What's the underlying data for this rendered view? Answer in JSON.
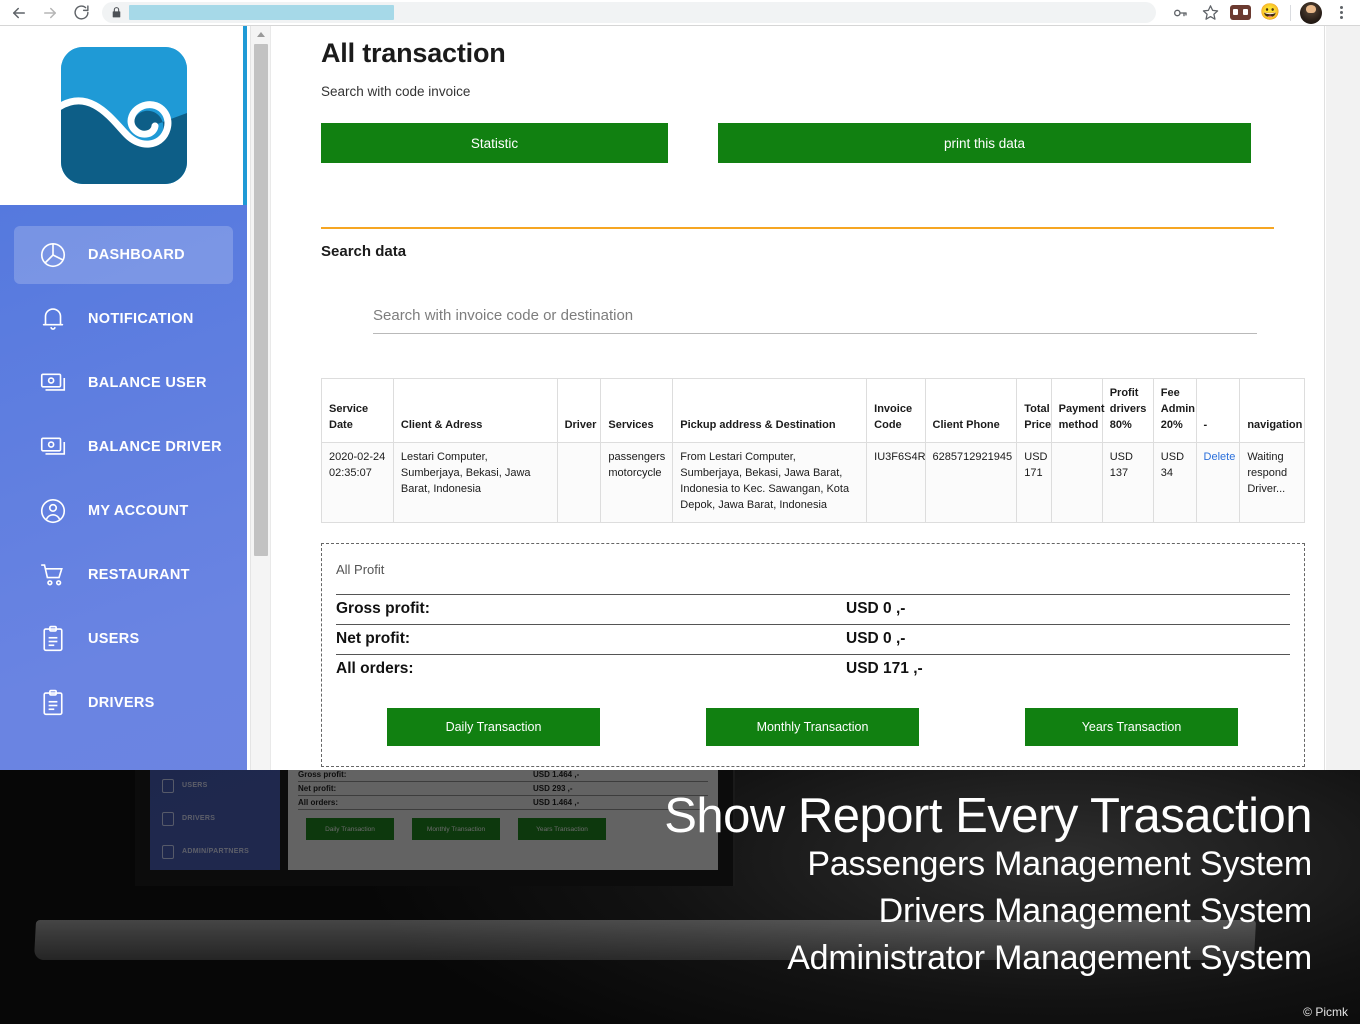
{
  "browser": {
    "back_icon": "back-arrow-icon",
    "forward_icon": "forward-arrow-icon",
    "reload_icon": "reload-icon",
    "lock_icon": "lock-icon",
    "url_value": "",
    "url_placeholder": "",
    "password_key_icon": "key-icon",
    "bookmark_icon": "star-icon",
    "extension_mask_icon": "mask-extension-icon",
    "extension_emoji_icon": "smiley-extension-icon",
    "profile_avatar": "profile-avatar",
    "menu_icon": "three-dot-menu-icon"
  },
  "sidebar": {
    "logo_alt": "wave-logo",
    "items": [
      {
        "label": "DASHBOARD",
        "icon": "pie-chart-icon",
        "active": true
      },
      {
        "label": "NOTIFICATION",
        "icon": "bell-icon",
        "active": false
      },
      {
        "label": "BALANCE USER",
        "icon": "banknotes-icon",
        "active": false
      },
      {
        "label": "BALANCE DRIVER",
        "icon": "banknotes-icon",
        "active": false
      },
      {
        "label": "MY ACCOUNT",
        "icon": "user-circle-icon",
        "active": false
      },
      {
        "label": "RESTAURANT",
        "icon": "cart-icon",
        "active": false
      },
      {
        "label": "USERS",
        "icon": "clipboard-icon",
        "active": false
      },
      {
        "label": "DRIVERS",
        "icon": "clipboard-icon",
        "active": false
      }
    ]
  },
  "main": {
    "title": "All transaction",
    "subtitle": "Search with code invoice",
    "statistic_button": "Statistic",
    "print_button": "print this data",
    "search_section_title": "Search data",
    "search_placeholder": "Search with invoice code or destination",
    "search_value": ""
  },
  "table": {
    "headers": [
      "Service Date",
      "Client & Adress",
      "Driver",
      "Services",
      "Pickup address & Destination",
      "Invoice Code",
      "Client Phone",
      "Total Price",
      "Payment method",
      "Profit drivers 80%",
      "Fee Admin 20%",
      "-",
      "navigation"
    ],
    "rows": [
      {
        "service_date": "2020-02-24 02:35:07",
        "client_address": "Lestari Computer, Sumberjaya, Bekasi, Jawa Barat, Indonesia",
        "driver": "",
        "services": "passengers motorcycle",
        "pickup_destination": "From Lestari Computer, Sumberjaya, Bekasi, Jawa Barat, Indonesia to Kec. Sawangan, Kota Depok, Jawa Barat, Indonesia",
        "invoice_code": "IU3F6S4R",
        "client_phone": "6285712921945",
        "total_price": "USD 171",
        "payment_method": "",
        "profit_drivers": "USD 137",
        "fee_admin": "USD 34",
        "delete_label": "Delete",
        "navigation": "Waiting respond Driver..."
      }
    ]
  },
  "profit": {
    "caption": "All Profit",
    "rows": [
      {
        "label": "Gross profit:",
        "value": "USD 0 ,-"
      },
      {
        "label": "Net profit:",
        "value": "USD 0 ,-"
      },
      {
        "label": "All orders:",
        "value": "USD 171 ,-"
      }
    ],
    "buttons": [
      "Daily Transaction",
      "Monthly Transaction",
      "Years Transaction"
    ]
  },
  "overlay": {
    "heading": "Show Report Every Trasaction",
    "lines": [
      "Passengers Management System",
      "Drivers Management System",
      "Administrator Management System"
    ],
    "credit": "© Picmk",
    "mini": {
      "nav": [
        "USERS",
        "DRIVERS",
        "ADMIN/PARTNERS"
      ],
      "rows": [
        {
          "label": "Gross profit:",
          "value": "USD 1.464 ,-"
        },
        {
          "label": "Net profit:",
          "value": "USD 293 ,-"
        },
        {
          "label": "All orders:",
          "value": "USD 1.464 ,-"
        }
      ],
      "buttons": [
        "Daily Transaction",
        "Monthly Transaction",
        "Years Transaction"
      ]
    }
  },
  "colors": {
    "green_button": "#118011",
    "sidebar_blue": "#6a84e2",
    "logo_blue": "#1f9ad6",
    "accent_orange": "#f6a623",
    "link_blue": "#2a6fdb"
  }
}
